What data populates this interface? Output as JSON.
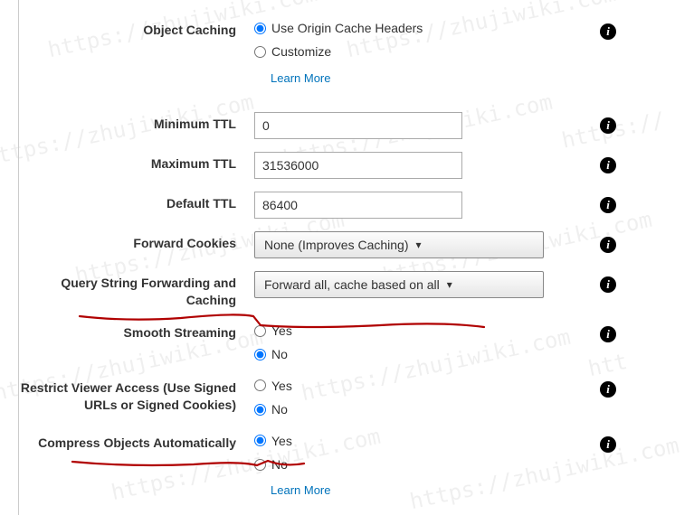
{
  "fields": {
    "object_caching": {
      "label": "Object Caching",
      "option1": "Use Origin Cache Headers",
      "option2": "Customize",
      "learn_more": "Learn More"
    },
    "min_ttl": {
      "label": "Minimum TTL",
      "value": "0"
    },
    "max_ttl": {
      "label": "Maximum TTL",
      "value": "31536000"
    },
    "default_ttl": {
      "label": "Default TTL",
      "value": "86400"
    },
    "forward_cookies": {
      "label": "Forward Cookies",
      "selected": "None (Improves Caching)"
    },
    "query_string": {
      "label": "Query String Forwarding and Caching",
      "selected": "Forward all, cache based on all"
    },
    "smooth_streaming": {
      "label": "Smooth Streaming",
      "yes": "Yes",
      "no": "No"
    },
    "restrict_viewer": {
      "label": "Restrict Viewer Access (Use Signed URLs or Signed Cookies)",
      "yes": "Yes",
      "no": "No"
    },
    "compress": {
      "label": "Compress Objects Automatically",
      "yes": "Yes",
      "no": "No",
      "learn_more": "Learn More"
    }
  },
  "watermark_text": "https://zhujiwiki.com",
  "annotations": {
    "color": "#b00000"
  }
}
